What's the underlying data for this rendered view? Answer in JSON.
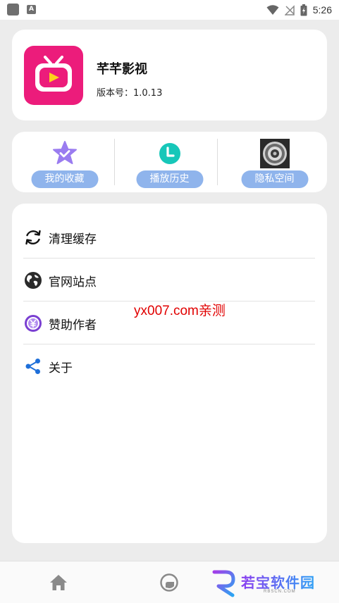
{
  "status_bar": {
    "time": "5:26",
    "notification_letter": "A"
  },
  "app_card": {
    "name": "芊芊影视",
    "version": "版本号：1.0.13"
  },
  "actions": [
    {
      "label": "我的收藏",
      "icon": "star-badge-icon"
    },
    {
      "label": "播放历史",
      "icon": "clock-icon"
    },
    {
      "label": "隐私空间",
      "icon": "lock-dial-icon"
    }
  ],
  "menu": [
    {
      "label": "清理缓存",
      "icon": "refresh-icon"
    },
    {
      "label": "官网站点",
      "icon": "globe-icon"
    },
    {
      "label": "赞助作者",
      "icon": "yen-coin-icon"
    },
    {
      "label": "关于",
      "icon": "share-icon"
    }
  ],
  "watermark": "yx007.com亲测",
  "bottom_nav": {
    "brand_text": "若宝软件园",
    "brand_sub": "RBSCN.COM"
  },
  "colors": {
    "app_icon": "#ec1c7b",
    "pill": "#8fb4ec",
    "watermark": "#e10000",
    "background": "#ececec"
  }
}
